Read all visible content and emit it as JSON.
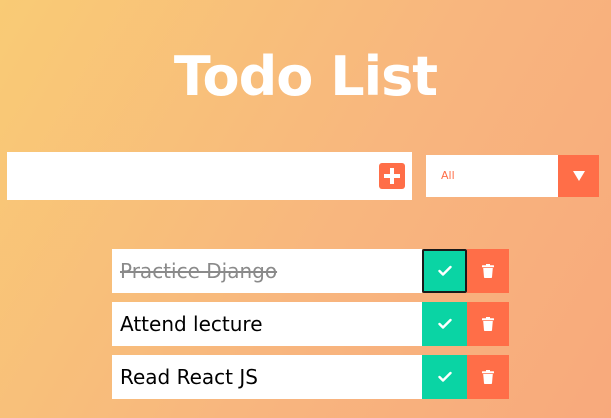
{
  "header": {
    "title": "Todo List"
  },
  "form": {
    "input_value": "",
    "input_placeholder": "",
    "add_icon": "plus-square-icon",
    "filter": {
      "selected": "All",
      "arrow_icon": "caret-down-icon"
    }
  },
  "todos": [
    {
      "text": "Practice Django",
      "completed": true
    },
    {
      "text": "Attend lecture",
      "completed": false
    },
    {
      "text": "Read React JS",
      "completed": false
    }
  ],
  "icons": {
    "complete": "check-icon",
    "delete": "trash-icon"
  },
  "colors": {
    "accent": "#ff6e48",
    "complete": "#0ad4a4",
    "background_start": "#f9cb75",
    "background_end": "#f8a97c",
    "completed_text": "#8a8a8a"
  }
}
